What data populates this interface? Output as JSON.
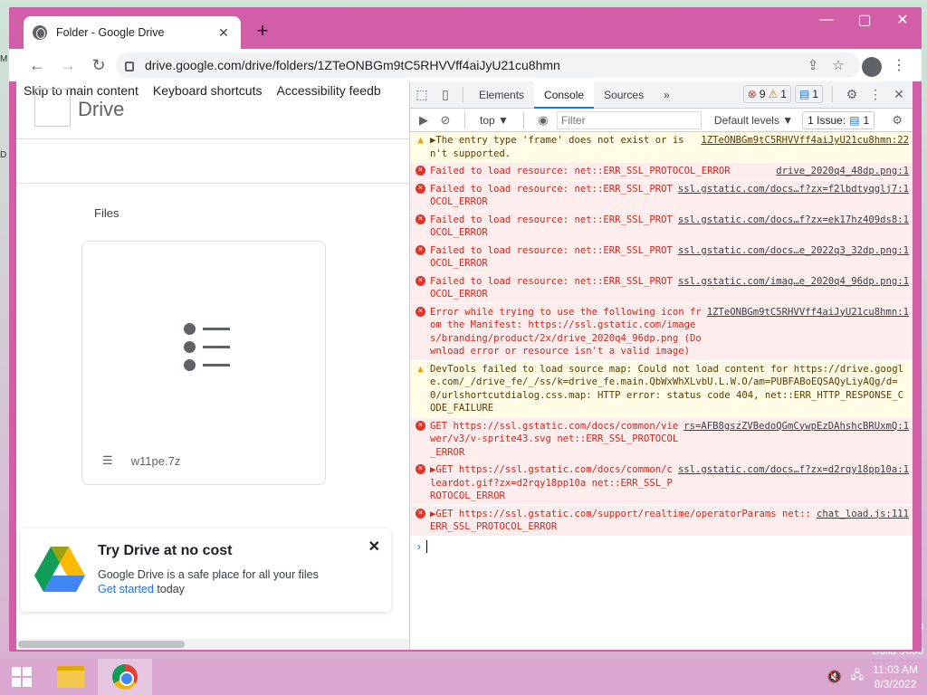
{
  "desktop": {
    "left_labels": [
      "M",
      "D"
    ],
    "right_labels": [
      "0",
      "Build 9600"
    ]
  },
  "browser": {
    "tab_title": "Folder - Google Drive",
    "tab_close": "✕",
    "new_tab": "+",
    "window_controls": {
      "minimize": "—",
      "maximize": "▢",
      "close": "✕"
    },
    "url": "drive.google.com/drive/folders/1ZTeONBGm9tC5RHVVff4aiJyU21cu8hmn"
  },
  "drive": {
    "skip_links": [
      "Skip to main content",
      "Keyboard shortcuts",
      "Accessibility feedb"
    ],
    "title": "Drive",
    "files_heading": "Files",
    "file_name": "w11pe.7z",
    "promo": {
      "heading": "Try Drive at no cost",
      "line1": "Google Drive is a safe place for all your files",
      "cta": "Get started",
      "cta_suffix": " today",
      "close": "✕"
    }
  },
  "devtools": {
    "tabs": [
      "Elements",
      "Console",
      "Sources"
    ],
    "active_tab": "Console",
    "more": "»",
    "errors_count": "9",
    "warnings_count": "1",
    "info_count": "1",
    "context": "top ▼",
    "filter_placeholder": "Filter",
    "levels": "Default levels ▼",
    "issues": "1 Issue:",
    "issues_count": "1",
    "prompt": "›",
    "messages": [
      {
        "level": "warn",
        "text": "▶The entry type 'frame' does not exist or isn't supported.",
        "source": "1ZTeONBGm9tC5RHVVff4aiJyU21cu8hmn:22"
      },
      {
        "level": "err",
        "text": "Failed to load resource: net::ERR_SSL_PROTOCOL_ERROR",
        "source": "drive_2020q4_48dp.png:1"
      },
      {
        "level": "err",
        "text": "Failed to load resource: net::ERR_SSL_PROTOCOL_ERROR",
        "source": "ssl.gstatic.com/docs…f?zx=f2lbdtyqglj7:1"
      },
      {
        "level": "err",
        "text": "Failed to load resource: net::ERR_SSL_PROTOCOL_ERROR",
        "source": "ssl.gstatic.com/docs…f?zx=ek17hz409ds8:1"
      },
      {
        "level": "err",
        "text": "Failed to load resource: net::ERR_SSL_PROTOCOL_ERROR",
        "source": "ssl.gstatic.com/docs…e_2022q3_32dp.png:1"
      },
      {
        "level": "err",
        "text": "Failed to load resource: net::ERR_SSL_PROTOCOL_ERROR",
        "source": "ssl.gstatic.com/imag…e_2020q4_96dp.png:1"
      },
      {
        "level": "err",
        "text": "Error while trying to use the following icon from the Manifest: https://ssl.gstatic.com/images/branding/product/2x/drive_2020q4_96dp.png (Download error or resource isn't a valid image)",
        "source": "1ZTeONBGm9tC5RHVVff4aiJyU21cu8hmn:1"
      },
      {
        "level": "warn",
        "text": "DevTools failed to load source map: Could not load content for https://drive.google.com/_/drive_fe/_/ss/k=drive_fe.main.QbWxWhXLvbU.L.W.O/am=PUBFABoEQSAQyLiyAQg/d=0/urlshortcutdialog.css.map: HTTP error: status code 404, net::ERR_HTTP_RESPONSE_CODE_FAILURE",
        "source": ""
      },
      {
        "level": "err",
        "text": "GET https://ssl.gstatic.com/docs/common/viewer/v3/v-sprite43.svg net::ERR_SSL_PROTOCOL_ERROR",
        "source": "rs=AFB8gszZVBedoQGmCywpEzDAhshcBRUxmQ:1"
      },
      {
        "level": "err",
        "text": "▶GET https://ssl.gstatic.com/docs/common/cleardot.gif?zx=d2rqy18pp10a net::ERR_SSL_PROTOCOL_ERROR",
        "source": "ssl.gstatic.com/docs…f?zx=d2rqy18pp10a:1"
      },
      {
        "level": "err",
        "text": "▶GET https://ssl.gstatic.com/support/realtime/operatorParams net::ERR_SSL_PROTOCOL_ERROR",
        "source": "chat_load.js:111"
      }
    ]
  },
  "taskbar": {
    "time": "11:03 AM",
    "date": "8/3/2022"
  },
  "colors": {
    "window_frame": "#d25ea8",
    "accent": "#1a73e8",
    "error": "#d93025",
    "warning": "#e6a300"
  }
}
